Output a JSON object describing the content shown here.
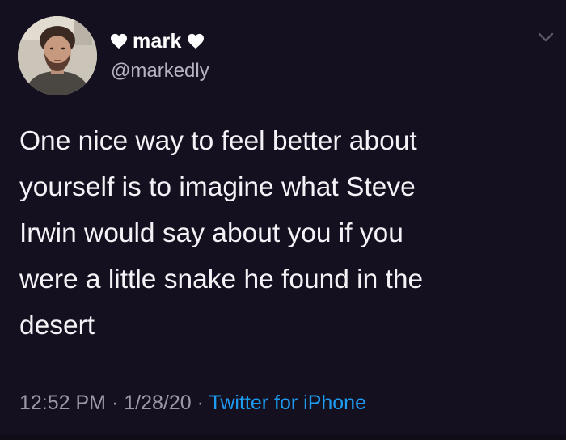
{
  "tweet": {
    "author": {
      "display_name": "mark",
      "handle": "@markedly",
      "name_icons": [
        "heart-icon",
        "heart-icon"
      ]
    },
    "text": "One nice way to feel better about\nyourself is to imagine what Steve\nIrwin would say about you if you\nwere a little snake he found in the\ndesert",
    "time": "12:52 PM",
    "separator": "·",
    "date": "1/28/20",
    "source": "Twitter for iPhone"
  },
  "colors": {
    "background": "#15101f",
    "text": "#f4f2f6",
    "muted": "#9c96a6",
    "link": "#1d9bf0"
  }
}
